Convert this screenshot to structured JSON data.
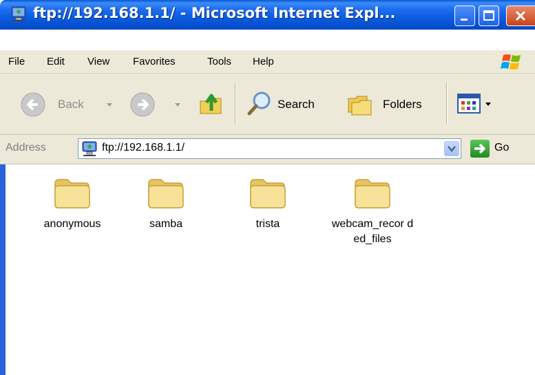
{
  "window": {
    "title": "ftp://192.168.1.1/ - Microsoft Internet Expl..."
  },
  "menu": [
    {
      "label": "File"
    },
    {
      "label": "Edit"
    },
    {
      "label": "View"
    },
    {
      "label": "Favorites"
    },
    {
      "label": "Tools"
    },
    {
      "label": "Help"
    }
  ],
  "toolbar": {
    "back_label": "Back",
    "search_label": "Search",
    "folders_label": "Folders"
  },
  "address": {
    "label": "Address",
    "value": "ftp://192.168.1.1/",
    "go_label": "Go"
  },
  "items": [
    {
      "name": "anonymous",
      "icon": "folder-icon"
    },
    {
      "name": "samba",
      "icon": "folder-icon"
    },
    {
      "name": "trista",
      "icon": "folder-icon"
    },
    {
      "name": "webcam_recor ded_files",
      "icon": "folder-icon"
    }
  ],
  "colors": {
    "titlebar": "#0a5ce0",
    "chrome": "#ece9d8",
    "accent": "#2a62d8"
  }
}
